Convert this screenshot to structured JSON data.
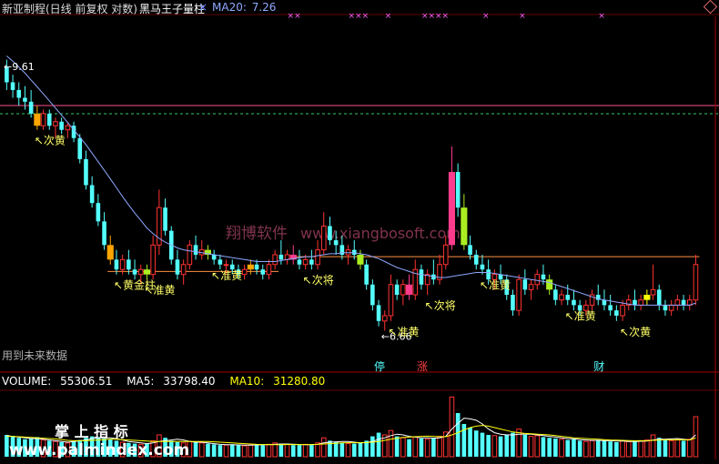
{
  "header": {
    "title": "新亚制程(日线 前复权 对数)",
    "indicator": "黑马王子量柱",
    "close_glyph": "×",
    "ma20_label": "MA20: ",
    "ma20_value": "7.26"
  },
  "volume_header": {
    "volume_label": "VOLUME: ",
    "volume_value": "55306.51",
    "ma5_label": "MA5: ",
    "ma5_value": "33798.40",
    "ma10_label": "MA10: ",
    "ma10_value": "31280.80"
  },
  "watermarks": {
    "site_cn": "翔博软件",
    "site_url": "www.xiangbosoft.com",
    "palm_cn": "掌 上 指 标",
    "palm_url": "www.palmindex.com",
    "future_data_note": "用到未来数据"
  },
  "colors": {
    "background": "#000000",
    "up": "#ff3232",
    "down": "#54ffff",
    "ma20": "#8fa8ff",
    "volume_ma5": "#ffffff",
    "volume_ma10": "#ffff00",
    "highlight_gold": "#ffa500",
    "highlight_yellow": "#ffff00",
    "highlight_green": "#aaee22",
    "highlight_pink": "#ff3c8c",
    "level_line": "#ff9040",
    "top_line": "#ff5090",
    "dashed_line": "#33cc66",
    "marker_text": "#ffff66",
    "tag_up": "#ff4040",
    "tag_stop": "#54ffff",
    "tag_finance": "#54ffff"
  },
  "chart_data": {
    "type": "candlestick",
    "price_scale": "log",
    "price_range": [
      6.4,
      10.3
    ],
    "volume_range": [
      0,
      90000
    ],
    "peak_label": "9.61",
    "low_label": "6.66",
    "ohlc": [
      [
        9.6,
        9.7,
        9.3,
        9.4
      ],
      [
        9.4,
        9.5,
        9.2,
        9.3
      ],
      [
        9.3,
        9.4,
        9.1,
        9.2
      ],
      [
        9.2,
        9.35,
        9.05,
        9.15
      ],
      [
        9.15,
        9.3,
        8.95,
        9.0
      ],
      [
        9.0,
        9.1,
        8.8,
        8.85
      ],
      [
        8.85,
        9.05,
        8.8,
        9.0
      ],
      [
        9.0,
        9.05,
        8.8,
        8.85
      ],
      [
        8.85,
        8.95,
        8.7,
        8.9
      ],
      [
        8.9,
        8.95,
        8.75,
        8.8
      ],
      [
        8.8,
        8.9,
        8.7,
        8.85
      ],
      [
        8.85,
        8.9,
        8.65,
        8.7
      ],
      [
        8.7,
        8.75,
        8.4,
        8.45
      ],
      [
        8.45,
        8.55,
        8.1,
        8.15
      ],
      [
        8.15,
        8.25,
        7.9,
        7.95
      ],
      [
        7.95,
        8.05,
        7.7,
        7.75
      ],
      [
        7.75,
        7.85,
        7.45,
        7.5
      ],
      [
        7.5,
        7.6,
        7.3,
        7.35
      ],
      [
        7.35,
        7.45,
        7.2,
        7.25
      ],
      [
        7.25,
        7.4,
        7.2,
        7.35
      ],
      [
        7.35,
        7.45,
        7.2,
        7.25
      ],
      [
        7.25,
        7.35,
        7.15,
        7.2
      ],
      [
        7.2,
        7.3,
        7.1,
        7.25
      ],
      [
        7.25,
        7.3,
        7.15,
        7.2
      ],
      [
        7.2,
        7.6,
        7.15,
        7.5
      ],
      [
        7.5,
        8.1,
        7.4,
        7.9
      ],
      [
        7.9,
        8.0,
        7.6,
        7.65
      ],
      [
        7.65,
        7.7,
        7.3,
        7.35
      ],
      [
        7.35,
        7.45,
        7.15,
        7.2
      ],
      [
        7.2,
        7.35,
        7.1,
        7.3
      ],
      [
        7.3,
        7.55,
        7.25,
        7.5
      ],
      [
        7.5,
        7.6,
        7.35,
        7.4
      ],
      [
        7.4,
        7.55,
        7.35,
        7.45
      ],
      [
        7.45,
        7.5,
        7.35,
        7.4
      ],
      [
        7.4,
        7.45,
        7.3,
        7.35
      ],
      [
        7.35,
        7.4,
        7.25,
        7.3
      ],
      [
        7.3,
        7.35,
        7.2,
        7.3
      ],
      [
        7.3,
        7.35,
        7.2,
        7.25
      ],
      [
        7.25,
        7.3,
        7.15,
        7.2
      ],
      [
        7.2,
        7.3,
        7.15,
        7.25
      ],
      [
        7.25,
        7.35,
        7.2,
        7.3
      ],
      [
        7.3,
        7.35,
        7.2,
        7.25
      ],
      [
        7.25,
        7.3,
        7.15,
        7.2
      ],
      [
        7.2,
        7.35,
        7.15,
        7.3
      ],
      [
        7.3,
        7.45,
        7.25,
        7.4
      ],
      [
        7.4,
        7.55,
        7.3,
        7.35
      ],
      [
        7.35,
        7.45,
        7.3,
        7.4
      ],
      [
        7.4,
        7.5,
        7.3,
        7.35
      ],
      [
        7.35,
        7.45,
        7.25,
        7.3
      ],
      [
        7.3,
        7.4,
        7.25,
        7.35
      ],
      [
        7.35,
        7.45,
        7.25,
        7.3
      ],
      [
        7.3,
        7.55,
        7.25,
        7.45
      ],
      [
        7.45,
        7.85,
        7.4,
        7.7
      ],
      [
        7.7,
        7.8,
        7.5,
        7.55
      ],
      [
        7.55,
        7.65,
        7.4,
        7.5
      ],
      [
        7.5,
        7.6,
        7.35,
        7.4
      ],
      [
        7.4,
        7.5,
        7.3,
        7.45
      ],
      [
        7.45,
        7.55,
        7.35,
        7.4
      ],
      [
        7.4,
        7.45,
        7.25,
        7.3
      ],
      [
        7.3,
        7.35,
        7.05,
        7.1
      ],
      [
        7.1,
        7.15,
        6.85,
        6.9
      ],
      [
        6.9,
        6.95,
        6.7,
        6.75
      ],
      [
        6.75,
        6.85,
        6.66,
        6.8
      ],
      [
        6.8,
        7.2,
        6.75,
        7.1
      ],
      [
        7.1,
        7.15,
        6.95,
        7.0
      ],
      [
        7.0,
        7.15,
        6.9,
        7.1
      ],
      [
        7.1,
        7.2,
        6.95,
        7.0
      ],
      [
        7.0,
        7.35,
        6.95,
        7.25
      ],
      [
        7.25,
        7.3,
        7.05,
        7.1
      ],
      [
        7.1,
        7.25,
        7.0,
        7.2
      ],
      [
        7.2,
        7.35,
        7.1,
        7.15
      ],
      [
        7.15,
        7.4,
        7.1,
        7.3
      ],
      [
        7.3,
        7.6,
        7.25,
        7.5
      ],
      [
        7.5,
        8.6,
        7.45,
        8.3
      ],
      [
        8.3,
        8.4,
        7.8,
        7.9
      ],
      [
        7.9,
        8.05,
        7.45,
        7.5
      ],
      [
        7.5,
        7.6,
        7.35,
        7.4
      ],
      [
        7.4,
        7.45,
        7.25,
        7.3
      ],
      [
        7.3,
        7.4,
        7.2,
        7.25
      ],
      [
        7.25,
        7.35,
        7.1,
        7.15
      ],
      [
        7.15,
        7.25,
        7.05,
        7.2
      ],
      [
        7.2,
        7.3,
        7.1,
        7.15
      ],
      [
        7.15,
        7.2,
        6.95,
        7.0
      ],
      [
        7.0,
        7.05,
        6.8,
        6.85
      ],
      [
        6.85,
        7.2,
        6.8,
        7.15
      ],
      [
        7.15,
        7.25,
        7.0,
        7.05
      ],
      [
        7.05,
        7.15,
        6.95,
        7.1
      ],
      [
        7.1,
        7.25,
        7.05,
        7.2
      ],
      [
        7.2,
        7.3,
        7.1,
        7.15
      ],
      [
        7.15,
        7.2,
        7.0,
        7.05
      ],
      [
        7.05,
        7.1,
        6.9,
        6.95
      ],
      [
        6.95,
        7.05,
        6.9,
        7.0
      ],
      [
        7.0,
        7.1,
        6.9,
        6.95
      ],
      [
        6.95,
        7.05,
        6.85,
        6.9
      ],
      [
        6.9,
        6.95,
        6.8,
        6.85
      ],
      [
        6.85,
        6.95,
        6.8,
        6.9
      ],
      [
        6.9,
        7.05,
        6.85,
        7.0
      ],
      [
        7.0,
        7.1,
        6.9,
        6.95
      ],
      [
        6.95,
        7.05,
        6.85,
        6.9
      ],
      [
        6.9,
        7.0,
        6.8,
        6.85
      ],
      [
        6.85,
        6.9,
        6.75,
        6.8
      ],
      [
        6.8,
        6.95,
        6.75,
        6.9
      ],
      [
        6.9,
        7.0,
        6.85,
        6.95
      ],
      [
        6.95,
        7.05,
        6.85,
        6.9
      ],
      [
        6.9,
        7.0,
        6.85,
        6.95
      ],
      [
        6.95,
        7.05,
        6.9,
        7.0
      ],
      [
        7.0,
        7.3,
        6.95,
        7.05
      ],
      [
        7.05,
        7.1,
        6.85,
        6.9
      ],
      [
        6.9,
        6.95,
        6.8,
        6.85
      ],
      [
        6.85,
        6.95,
        6.8,
        6.9
      ],
      [
        6.9,
        7.0,
        6.85,
        6.95
      ],
      [
        6.95,
        7.0,
        6.85,
        6.9
      ],
      [
        6.9,
        7.0,
        6.85,
        6.95
      ],
      [
        6.95,
        7.4,
        6.9,
        7.3
      ]
    ],
    "volume": [
      30000,
      28000,
      26000,
      24000,
      25000,
      27000,
      23000,
      22000,
      21000,
      20000,
      19000,
      21000,
      23000,
      26000,
      28000,
      27000,
      25000,
      24000,
      22000,
      20000,
      19000,
      18000,
      17000,
      18000,
      22000,
      30000,
      26000,
      22000,
      20000,
      19000,
      21000,
      20000,
      19000,
      18000,
      17000,
      16000,
      16000,
      17000,
      16000,
      15000,
      16000,
      17000,
      16000,
      17000,
      19000,
      18000,
      17000,
      16000,
      16000,
      17000,
      16000,
      19000,
      26000,
      22000,
      20000,
      19000,
      18000,
      18000,
      19000,
      22000,
      28000,
      33000,
      30000,
      36000,
      28000,
      26000,
      24000,
      27000,
      25000,
      24000,
      26000,
      28000,
      34000,
      82000,
      60000,
      45000,
      40000,
      36000,
      33000,
      30000,
      29000,
      28000,
      30000,
      33000,
      38000,
      30000,
      28000,
      29000,
      27000,
      26000,
      25000,
      24000,
      23000,
      24000,
      22000,
      21000,
      22000,
      23000,
      22000,
      21000,
      20000,
      22000,
      21000,
      21000,
      22000,
      23000,
      30000,
      26000,
      23000,
      22000,
      23000,
      22000,
      24000,
      55000
    ],
    "volume_ma5": [
      29000,
      28000,
      27000,
      26000,
      25000,
      25000,
      24000,
      23000,
      22000,
      21000,
      20000,
      21000,
      22000,
      23000,
      25000,
      26000,
      26000,
      26000,
      25000,
      23000,
      21000,
      20000,
      19000,
      18000,
      19000,
      21000,
      22000,
      23000,
      24000,
      23000,
      21000,
      20000,
      20000,
      19000,
      18000,
      17000,
      16500,
      16500,
      16300,
      16000,
      16000,
      16200,
      16500,
      16500,
      17000,
      17500,
      17500,
      17200,
      16800,
      16600,
      16500,
      17000,
      19000,
      20000,
      20500,
      21000,
      21000,
      20000,
      19000,
      19500,
      21000,
      24000,
      26000,
      29000,
      31000,
      30000,
      28000,
      27000,
      26000,
      26000,
      25500,
      26000,
      28000,
      38000,
      46000,
      53000,
      52000,
      50000,
      45000,
      38000,
      33000,
      31000,
      30000,
      30000,
      31000,
      31000,
      31000,
      30000,
      29000,
      28000,
      27000,
      26000,
      25000,
      24500,
      23500,
      23000,
      22500,
      22500,
      22200,
      22000,
      21500,
      21500,
      21000,
      21000,
      21200,
      21500,
      23000,
      24000,
      24000,
      24500,
      25000,
      24000,
      23000,
      30000
    ],
    "volume_ma10": [
      28000,
      28000,
      27500,
      27000,
      26500,
      26000,
      25500,
      25000,
      24500,
      23500,
      22500,
      22000,
      22000,
      22000,
      22500,
      23000,
      23500,
      24000,
      24000,
      23500,
      23000,
      22500,
      22000,
      21500,
      21000,
      21000,
      21000,
      21000,
      21000,
      21000,
      21000,
      21000,
      21000,
      21000,
      20500,
      20000,
      19500,
      19000,
      18500,
      18000,
      17500,
      17000,
      16800,
      16700,
      16600,
      16600,
      16700,
      16800,
      16800,
      16800,
      16800,
      17000,
      17500,
      18000,
      18500,
      19000,
      19200,
      19200,
      19300,
      19500,
      20000,
      21000,
      22500,
      24000,
      25500,
      26500,
      27000,
      27500,
      28000,
      28200,
      28000,
      27500,
      27500,
      30000,
      33000,
      37000,
      40000,
      42000,
      43000,
      42000,
      40000,
      38000,
      36000,
      34000,
      33000,
      32000,
      31500,
      31000,
      30500,
      30000,
      29000,
      28000,
      27000,
      26000,
      25500,
      25000,
      24500,
      24000,
      23500,
      23000,
      22800,
      22500,
      22300,
      22000,
      22000,
      22000,
      22500,
      23000,
      23200,
      23300,
      23400,
      23200,
      23000,
      26000
    ],
    "ma20": [
      9.75,
      9.68,
      9.6,
      9.52,
      9.43,
      9.34,
      9.25,
      9.16,
      9.07,
      8.98,
      8.89,
      8.8,
      8.71,
      8.62,
      8.52,
      8.42,
      8.32,
      8.22,
      8.12,
      8.02,
      7.93,
      7.84,
      7.76,
      7.68,
      7.62,
      7.57,
      7.53,
      7.5,
      7.47,
      7.45,
      7.44,
      7.43,
      7.42,
      7.41,
      7.4,
      7.39,
      7.38,
      7.37,
      7.36,
      7.35,
      7.34,
      7.33,
      7.33,
      7.33,
      7.33,
      7.34,
      7.35,
      7.36,
      7.37,
      7.38,
      7.38,
      7.39,
      7.4,
      7.41,
      7.41,
      7.42,
      7.42,
      7.42,
      7.41,
      7.4,
      7.38,
      7.36,
      7.33,
      7.3,
      7.27,
      7.25,
      7.23,
      7.21,
      7.2,
      7.19,
      7.18,
      7.17,
      7.17,
      7.18,
      7.19,
      7.2,
      7.21,
      7.22,
      7.22,
      7.22,
      7.21,
      7.2,
      7.19,
      7.18,
      7.17,
      7.16,
      7.15,
      7.14,
      7.13,
      7.12,
      7.1,
      7.08,
      7.06,
      7.04,
      7.02,
      7.0,
      6.98,
      6.96,
      6.95,
      6.94,
      6.93,
      6.92,
      6.91,
      6.9,
      6.9,
      6.9,
      6.9,
      6.9,
      6.9,
      6.9,
      6.9,
      6.9,
      6.9,
      6.92
    ],
    "highlight_bars": [
      {
        "i": 5,
        "kind": "gold"
      },
      {
        "i": 17,
        "kind": "gold"
      },
      {
        "i": 23,
        "kind": "green"
      },
      {
        "i": 33,
        "kind": "green"
      },
      {
        "i": 40,
        "kind": "gold"
      },
      {
        "i": 47,
        "kind": "pink"
      },
      {
        "i": 58,
        "kind": "green"
      },
      {
        "i": 66,
        "kind": "pink"
      },
      {
        "i": 73,
        "kind": "pink"
      },
      {
        "i": 75,
        "kind": "green"
      },
      {
        "i": 89,
        "kind": "green"
      },
      {
        "i": 105,
        "kind": "yellow"
      }
    ],
    "signal_labels": [
      {
        "i": 5,
        "text": "次黄"
      },
      {
        "i": 18,
        "text": "黄金柱"
      },
      {
        "i": 23,
        "text": "准黄"
      },
      {
        "i": 34,
        "text": "准黄"
      },
      {
        "i": 49,
        "text": "次将"
      },
      {
        "i": 63,
        "text": "准黄"
      },
      {
        "i": 69,
        "text": "次将"
      },
      {
        "i": 78,
        "text": "准黄"
      },
      {
        "i": 92,
        "text": "准黄"
      },
      {
        "i": 101,
        "text": "次黄"
      }
    ],
    "bottom_tags": [
      {
        "i": 61,
        "text": "停"
      },
      {
        "i": 68,
        "text": "涨"
      },
      {
        "i": 97,
        "text": "财"
      }
    ],
    "top_markers": [
      {
        "i": 46,
        "text": "××"
      },
      {
        "i": 56,
        "text": "×××"
      },
      {
        "i": 62,
        "text": "×"
      },
      {
        "i": 68,
        "text": "××××"
      },
      {
        "i": 78,
        "text": "×"
      },
      {
        "i": 84,
        "text": "×"
      },
      {
        "i": 97,
        "text": "×"
      }
    ],
    "level_lines": [
      {
        "price": 7.23,
        "from": 17,
        "to": 44
      },
      {
        "price": 7.38,
        "from": 47,
        "to": 113
      }
    ]
  }
}
